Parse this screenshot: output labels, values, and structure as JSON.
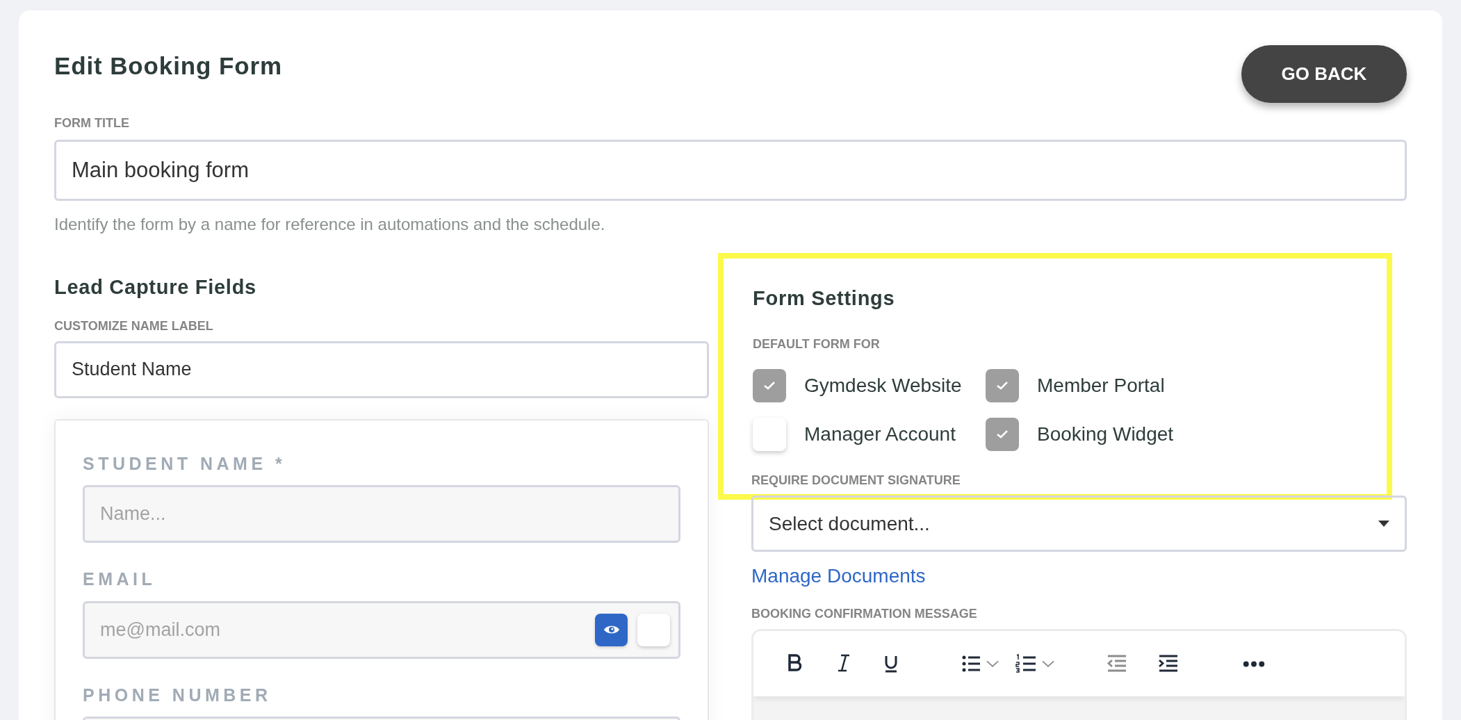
{
  "title": "Edit Booking Form",
  "back_button": "GO BACK",
  "form_title": {
    "label": "FORM TITLE",
    "value": "Main booking form",
    "help": "Identify the form by a name for reference in automations and the schedule."
  },
  "lead_capture": {
    "heading": "Lead Capture Fields",
    "name_label": {
      "label": "CUSTOMIZE NAME LABEL",
      "value": "Student Name"
    },
    "preview_fields": [
      {
        "label": "STUDENT NAME *",
        "placeholder": "Name..."
      },
      {
        "label": "EMAIL",
        "placeholder": "me@mail.com",
        "toggles": {
          "visible": true,
          "required": false
        }
      },
      {
        "label": "PHONE NUMBER"
      }
    ]
  },
  "form_settings": {
    "heading": "Form Settings",
    "highlighted": true,
    "default_for_label": "DEFAULT FORM FOR",
    "default_for": [
      {
        "label": "Gymdesk Website",
        "checked": true
      },
      {
        "label": "Member Portal",
        "checked": true
      },
      {
        "label": "Manager Account",
        "checked": false
      },
      {
        "label": "Booking Widget",
        "checked": true
      }
    ]
  },
  "document_signature": {
    "label": "REQUIRE DOCUMENT SIGNATURE",
    "value": "Select document...",
    "link": "Manage Documents"
  },
  "confirmation_message": {
    "label": "BOOKING CONFIRMATION MESSAGE"
  }
}
